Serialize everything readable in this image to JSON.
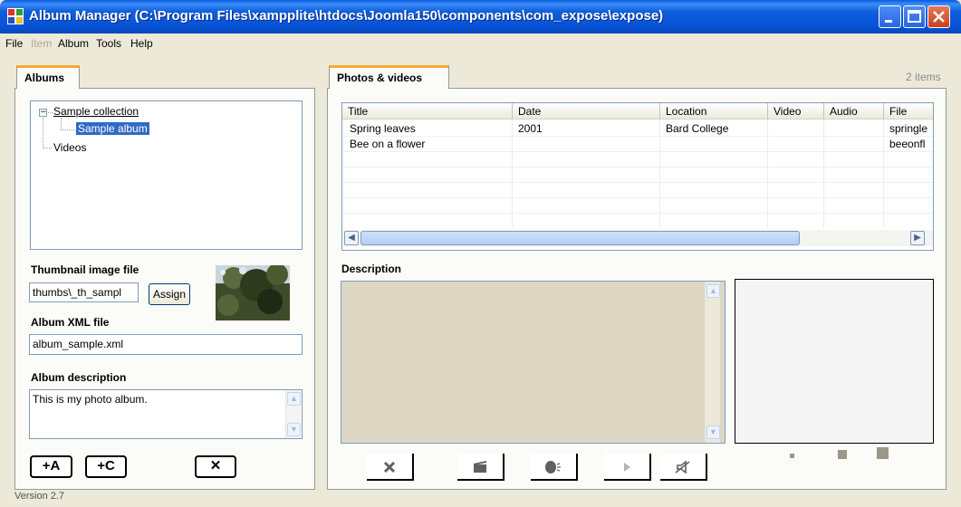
{
  "window": {
    "title": "Album Manager (C:\\Program Files\\xampplite\\htdocs\\Joomla150\\components\\com_expose\\expose)"
  },
  "menu": [
    "File",
    "Item",
    "Album",
    "Tools",
    "Help"
  ],
  "menu_disabled": [
    "Item"
  ],
  "albums_tab": {
    "label": "Albums",
    "tree": {
      "root": "Sample collection",
      "child": "Sample album",
      "videos": "Videos"
    },
    "thumbnail_label": "Thumbnail image file",
    "thumbnail_value": "thumbs\\_th_sampl",
    "assign_label": "Assign",
    "xml_label": "Album XML file",
    "xml_value": "album_sample.xml",
    "description_label": "Album description",
    "description_value": "This is my photo album.",
    "add_album_label": "+A",
    "add_collection_label": "+C",
    "delete_label": "✕"
  },
  "photos_tab": {
    "label": "Photos & videos",
    "item_count": "2 items",
    "columns": [
      "Title",
      "Date",
      "Location",
      "Video",
      "Audio",
      "File"
    ],
    "rows": [
      [
        "Spring leaves",
        "2001",
        "Bard College",
        "",
        "",
        "springle"
      ],
      [
        "Bee on a flower",
        "",
        "",
        "",
        "",
        "beeonfl"
      ]
    ],
    "description_label": "Description"
  },
  "icons": {
    "delete": "x-icon",
    "clapper": "clapperboard-icon",
    "speaker": "speaking-head-icon",
    "play": "play-icon",
    "mute": "mute-icon"
  },
  "status": {
    "version": "Version 2.7"
  },
  "colors": {
    "titlebar": "#0a5be0",
    "selection": "#316ac5",
    "tab_accent": "#f7a932",
    "background": "#ece9d8"
  }
}
